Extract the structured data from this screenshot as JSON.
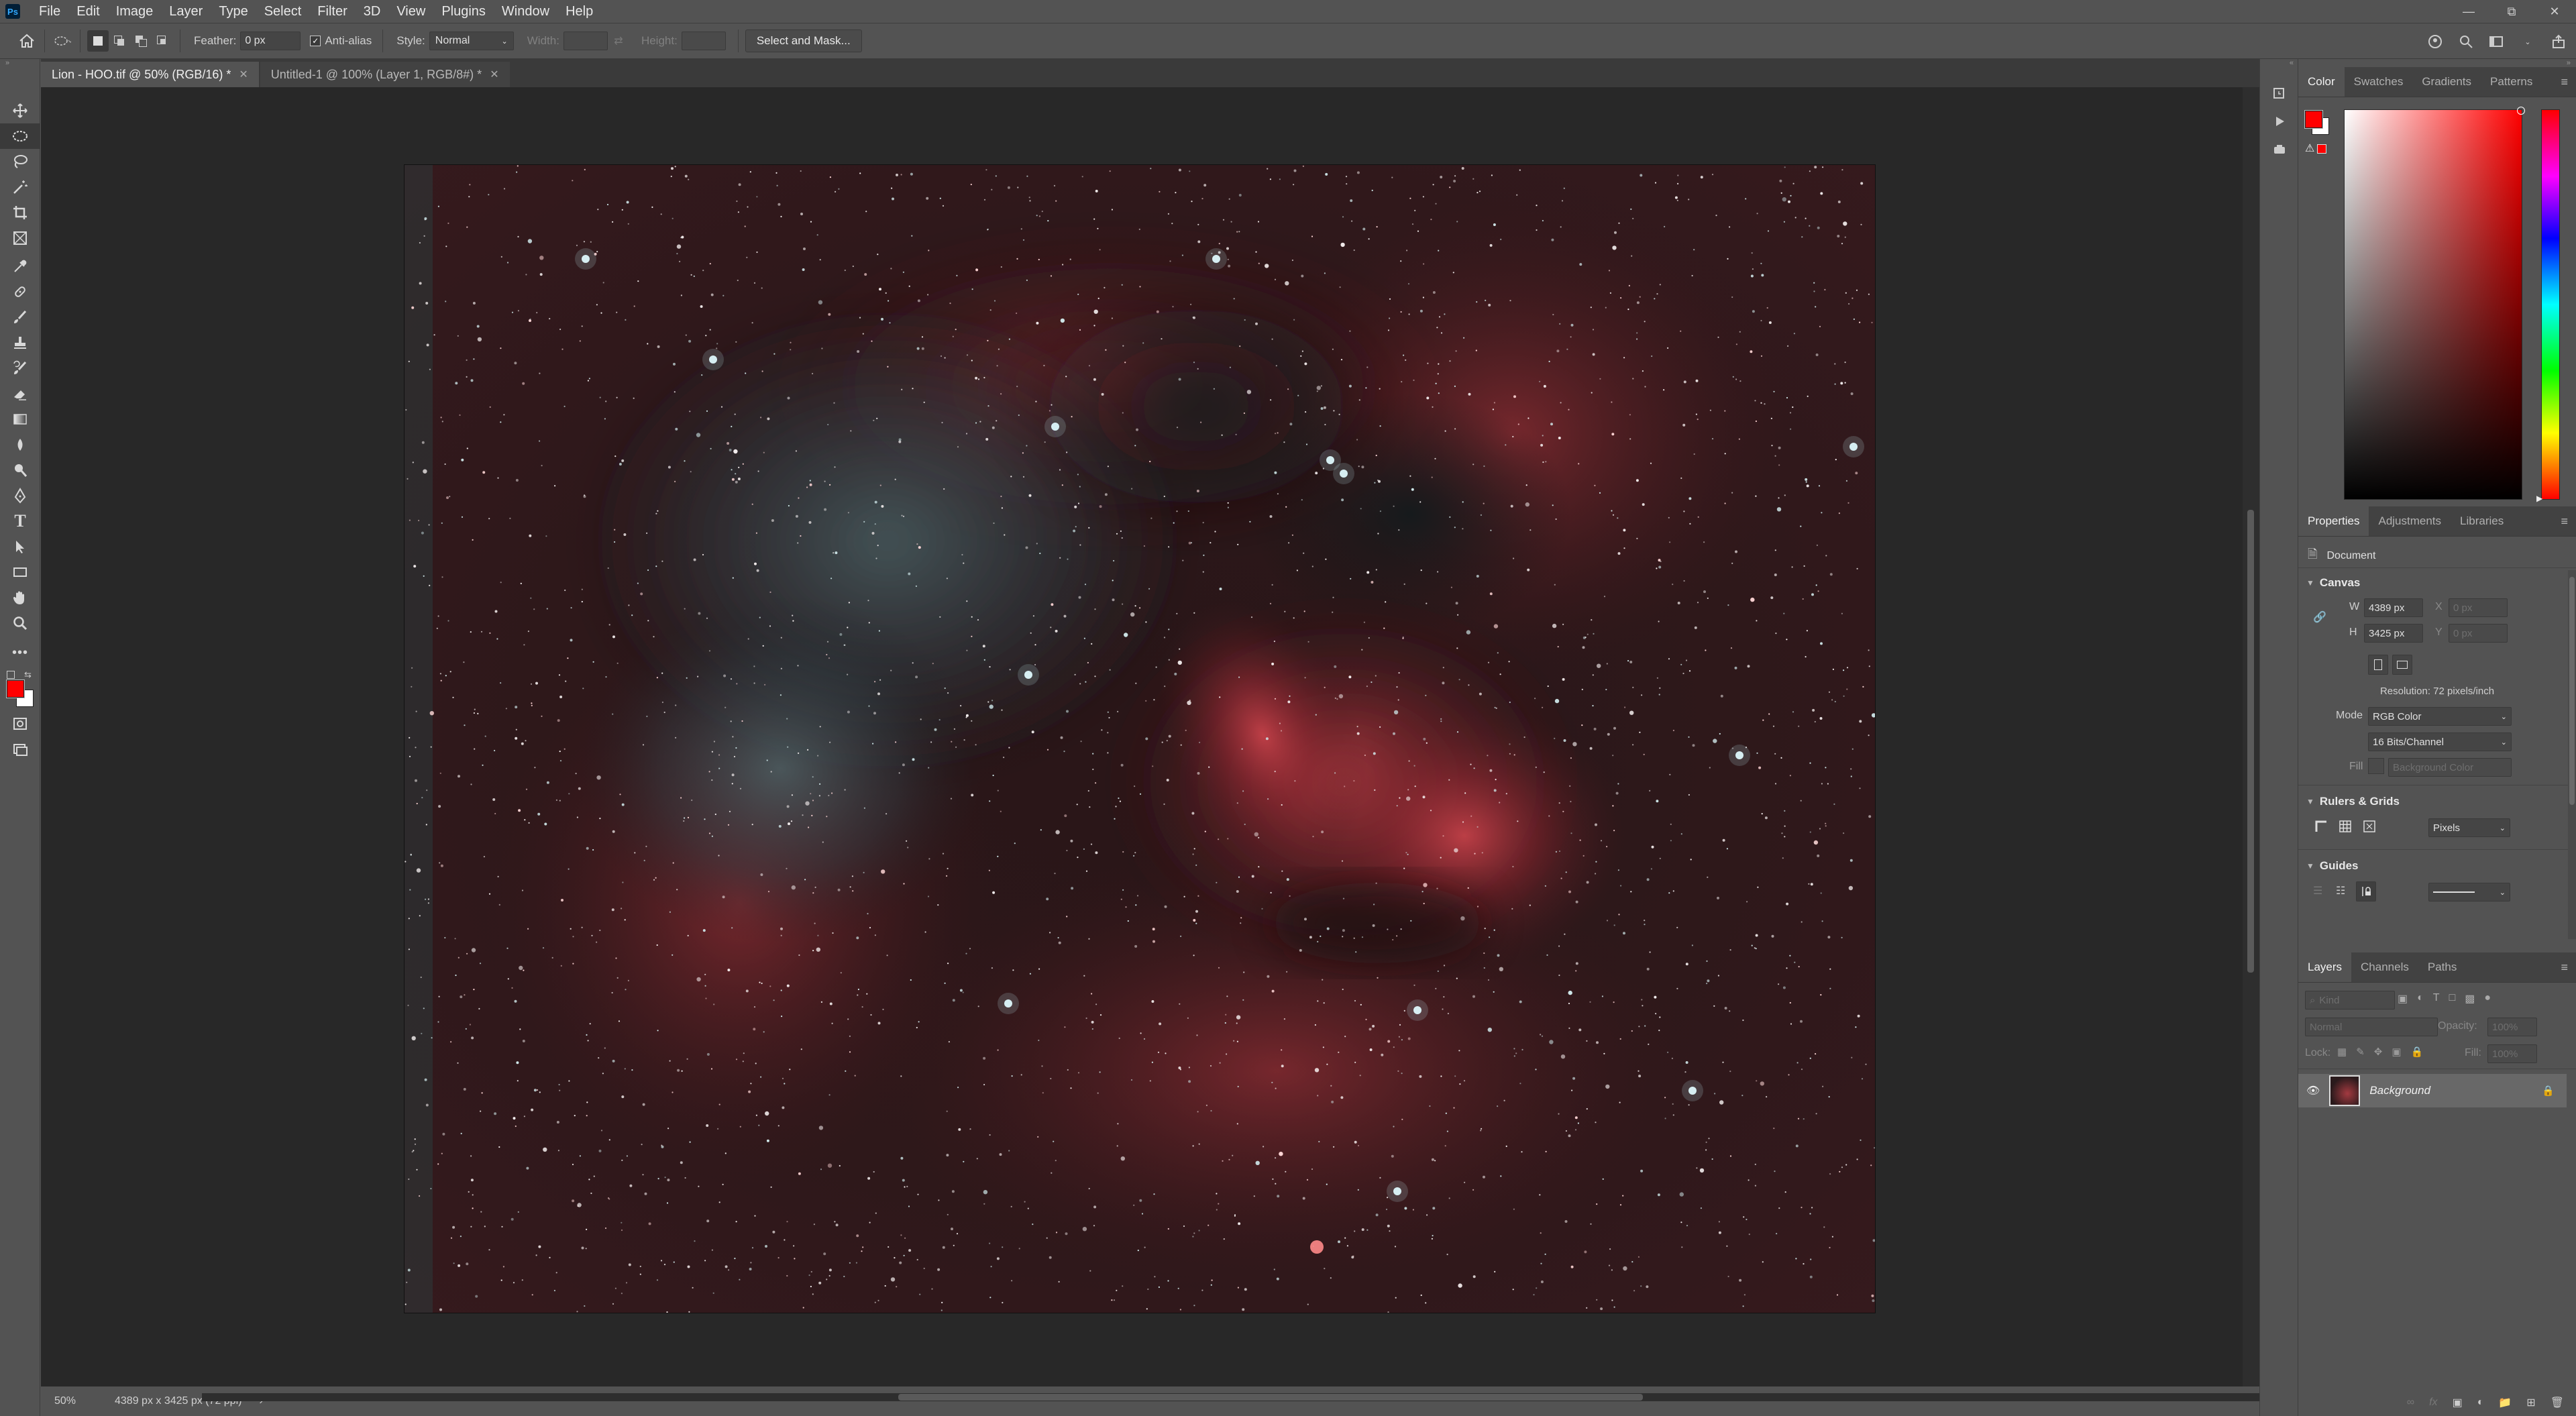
{
  "menubar": {
    "logo": "Ps",
    "items": [
      "File",
      "Edit",
      "Image",
      "Layer",
      "Type",
      "Select",
      "Filter",
      "3D",
      "View",
      "Plugins",
      "Window",
      "Help"
    ]
  },
  "options": {
    "feather_label": "Feather:",
    "feather_value": "0 px",
    "antialias_label": "Anti-alias",
    "antialias_checked": true,
    "style_label": "Style:",
    "style_value": "Normal",
    "width_label": "Width:",
    "height_label": "Height:",
    "select_mask_label": "Select and Mask..."
  },
  "tools": [
    "move-tool",
    "marquee-tool",
    "lasso-tool",
    "magic-wand-tool",
    "crop-tool",
    "frame-tool",
    "eyedropper-tool",
    "healing-brush-tool",
    "brush-tool",
    "clone-stamp-tool",
    "history-brush-tool",
    "eraser-tool",
    "gradient-tool",
    "blur-tool",
    "dodge-tool",
    "pen-tool",
    "type-tool",
    "path-selection-tool",
    "rectangle-tool",
    "hand-tool",
    "zoom-tool",
    "more-tools"
  ],
  "colors": {
    "foreground": "#ff0000",
    "background": "#ffffff",
    "accent": "#31a8ff"
  },
  "document_tabs": [
    {
      "label": "Lion - HOO.tif @ 50% (RGB/16) *",
      "active": true
    },
    {
      "label": "Untitled-1 @ 100% (Layer 1, RGB/8#) *",
      "active": false
    }
  ],
  "status": {
    "zoom": "50%",
    "info": "4389 px x 3425 px (72 ppi)",
    "arrow": "›"
  },
  "color_panel": {
    "tabs": [
      "Color",
      "Swatches",
      "Gradients",
      "Patterns"
    ],
    "active": "Color"
  },
  "properties_panel": {
    "tabs": [
      "Properties",
      "Adjustments",
      "Libraries"
    ],
    "active": "Properties",
    "doc_type": "Document",
    "canvas_head": "Canvas",
    "w_label": "W",
    "w_value": "4389 px",
    "h_label": "H",
    "h_value": "3425 px",
    "x_label": "X",
    "x_value": "0 px",
    "y_label": "Y",
    "y_value": "0 px",
    "resolution": "Resolution: 72 pixels/inch",
    "mode_label": "Mode",
    "mode_value": "RGB Color",
    "depth_value": "16 Bits/Channel",
    "fill_label": "Fill",
    "fill_value": "Background Color",
    "rulers_head": "Rulers & Grids",
    "units_value": "Pixels",
    "guides_head": "Guides"
  },
  "layers_panel": {
    "tabs": [
      "Layers",
      "Channels",
      "Paths"
    ],
    "active": "Layers",
    "kind_placeholder": "Kind",
    "blend_value": "Normal",
    "opacity_label": "Opacity:",
    "opacity_value": "100%",
    "lock_label": "Lock:",
    "fill_label": "Fill:",
    "fill_value": "100%",
    "layers": [
      {
        "name": "Background",
        "visible": true,
        "locked": true
      }
    ]
  }
}
